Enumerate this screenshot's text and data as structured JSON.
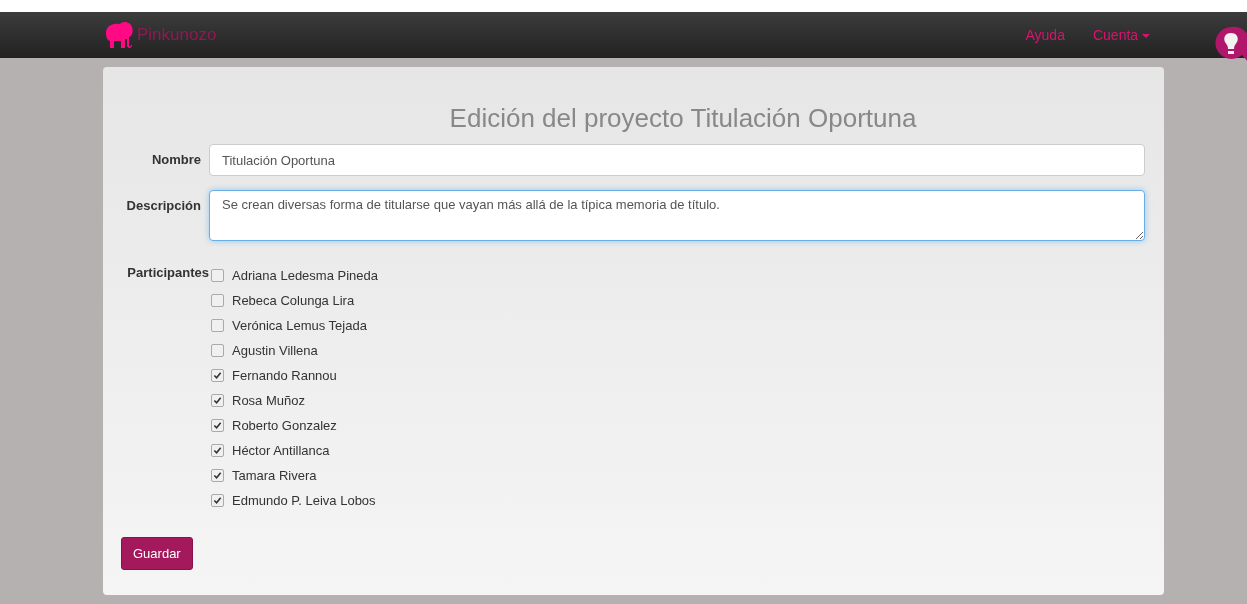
{
  "navbar": {
    "brand": "Pinkunozo",
    "links": [
      {
        "label": "Ayuda",
        "kind": "link"
      },
      {
        "label": "Cuenta",
        "kind": "dropdown"
      }
    ]
  },
  "form": {
    "title": "Edición del proyecto Titulación Oportuna",
    "name": {
      "label": "Nombre",
      "value": "Titulación Oportuna"
    },
    "description": {
      "label": "Descripción",
      "value": "Se crean diversas forma de titularse que vayan más allá de la típica memoria de título."
    },
    "participants": {
      "label": "Participantes",
      "items": [
        {
          "name": "Adriana Ledesma Pineda",
          "checked": false
        },
        {
          "name": "Rebeca Colunga Lira",
          "checked": false
        },
        {
          "name": "Verónica Lemus Tejada",
          "checked": false
        },
        {
          "name": "Agustin Villena",
          "checked": false
        },
        {
          "name": "Fernando Rannou",
          "checked": true
        },
        {
          "name": "Rosa Muñoz",
          "checked": true
        },
        {
          "name": "Roberto Gonzalez",
          "checked": true
        },
        {
          "name": "Héctor Antillanca",
          "checked": true
        },
        {
          "name": "Tamara Rivera",
          "checked": true
        },
        {
          "name": "Edmundo P. Leiva Lobos",
          "checked": true
        }
      ]
    },
    "submit": "Guardar"
  }
}
